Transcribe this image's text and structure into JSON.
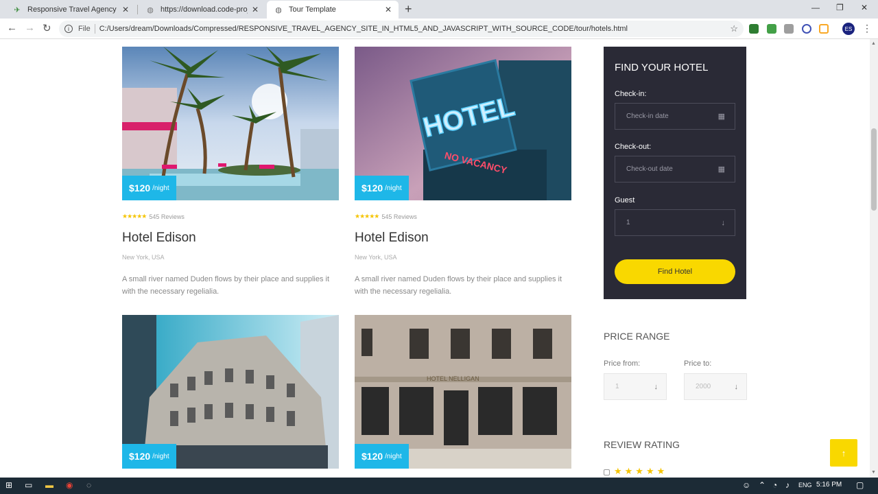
{
  "browser": {
    "tabs": [
      {
        "title": "Responsive Travel Agency Site In",
        "active": false
      },
      {
        "title": "https://download.code-projects.o",
        "active": false
      },
      {
        "title": "Tour Template",
        "active": true
      }
    ],
    "file_label": "File",
    "url": "C:/Users/dream/Downloads/Compressed/RESPONSIVE_TRAVEL_AGENCY_SITE_IN_HTML5_AND_JAVASCRIPT_WITH_SOURCE_CODE/tour/hotels.html",
    "avatar_text": "ES"
  },
  "hotels": [
    {
      "price": "$120",
      "unit": "/night",
      "reviews": "545 Reviews",
      "name": "Hotel Edison",
      "location": "New York, USA",
      "description": "A small river named Duden flows by their place and supplies it with the necessary regelialia."
    },
    {
      "price": "$120",
      "unit": "/night",
      "reviews": "545 Reviews",
      "name": "Hotel Edison",
      "location": "New York, USA",
      "description": "A small river named Duden flows by their place and supplies it with the necessary regelialia."
    },
    {
      "price": "$120",
      "unit": "/night"
    },
    {
      "price": "$120",
      "unit": "/night"
    }
  ],
  "sign_text": {
    "hotel": "HOTEL",
    "vacancy": "NO VACANCY",
    "nelligan": "HOTEL NELLIGAN"
  },
  "finder": {
    "title": "FIND YOUR HOTEL",
    "checkin_label": "Check-in:",
    "checkin_placeholder": "Check-in date",
    "checkout_label": "Check-out:",
    "checkout_placeholder": "Check-out date",
    "guest_label": "Guest",
    "guest_value": "1",
    "button": "Find Hotel"
  },
  "price_range": {
    "title": "PRICE RANGE",
    "from_label": "Price from:",
    "from_value": "1",
    "to_label": "Price to:",
    "to_value": "2000"
  },
  "review_rating": {
    "title": "REVIEW RATING",
    "stars": 5
  },
  "taskbar": {
    "lang": "ENG",
    "time": "5:16 PM"
  },
  "colors": {
    "accent_blue": "#1eb7e8",
    "accent_yellow": "#f9d800",
    "panel_dark": "#2a2a36"
  }
}
